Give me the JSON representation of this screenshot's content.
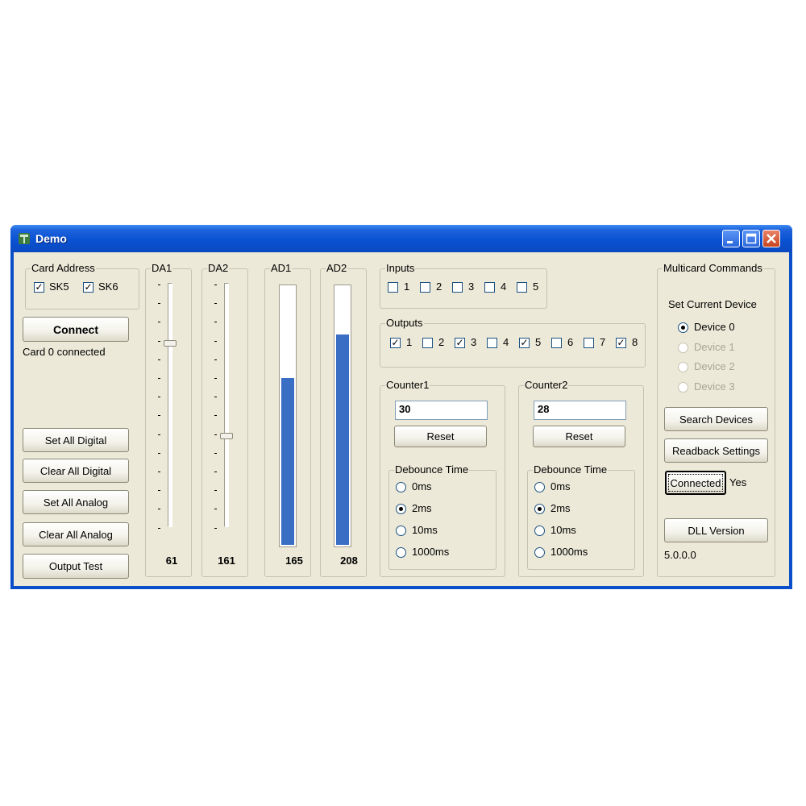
{
  "window": {
    "title": "Demo"
  },
  "card_address": {
    "group_label": "Card Address",
    "sk5": {
      "label": "SK5",
      "checked": true
    },
    "sk6": {
      "label": "SK6",
      "checked": true
    }
  },
  "connect": {
    "button_label": "Connect",
    "status": "Card 0 connected"
  },
  "left_buttons": {
    "set_all_digital": "Set All Digital",
    "clear_all_digital": "Clear All Digital",
    "set_all_analog": "Set All Analog",
    "clear_all_analog": "Clear All Analog",
    "output_test": "Output Test"
  },
  "sliders": {
    "da1": {
      "label": "DA1",
      "value": "61",
      "level": 61,
      "max": 255
    },
    "da2": {
      "label": "DA2",
      "value": "161",
      "level": 161,
      "max": 255
    }
  },
  "bars": {
    "ad1": {
      "label": "AD1",
      "value": "165",
      "level": 165,
      "max": 255
    },
    "ad2": {
      "label": "AD2",
      "value": "208",
      "level": 208,
      "max": 255
    }
  },
  "inputs": {
    "group_label": "Inputs",
    "items": [
      {
        "label": "1",
        "checked": false
      },
      {
        "label": "2",
        "checked": false
      },
      {
        "label": "3",
        "checked": false
      },
      {
        "label": "4",
        "checked": false
      },
      {
        "label": "5",
        "checked": false
      }
    ]
  },
  "outputs": {
    "group_label": "Outputs",
    "items": [
      {
        "label": "1",
        "checked": true
      },
      {
        "label": "2",
        "checked": false
      },
      {
        "label": "3",
        "checked": true
      },
      {
        "label": "4",
        "checked": false
      },
      {
        "label": "5",
        "checked": true
      },
      {
        "label": "6",
        "checked": false
      },
      {
        "label": "7",
        "checked": false
      },
      {
        "label": "8",
        "checked": true
      }
    ]
  },
  "counter1": {
    "group_label": "Counter1",
    "value": "30",
    "reset_label": "Reset",
    "debounce_label": "Debounce Time",
    "options": [
      "0ms",
      "2ms",
      "10ms",
      "1000ms"
    ],
    "selected": "2ms"
  },
  "counter2": {
    "group_label": "Counter2",
    "value": "28",
    "reset_label": "Reset",
    "debounce_label": "Debounce Time",
    "options": [
      "0ms",
      "2ms",
      "10ms",
      "1000ms"
    ],
    "selected": "2ms"
  },
  "multicard": {
    "group_label": "Multicard Commands",
    "set_device_label": "Set Current Device",
    "devices": [
      {
        "label": "Device 0",
        "selected": true,
        "enabled": true
      },
      {
        "label": "Device 1",
        "selected": false,
        "enabled": false
      },
      {
        "label": "Device 2",
        "selected": false,
        "enabled": false
      },
      {
        "label": "Device 3",
        "selected": false,
        "enabled": false
      }
    ],
    "search_label": "Search Devices",
    "readback_label": "Readback Settings",
    "connected_label": "Connected",
    "connected_value": "Yes",
    "dll_label": "DLL Version",
    "dll_value": "5.0.0.0"
  },
  "colors": {
    "title_blue": "#0a52d3",
    "face": "#ece9d8",
    "bar_fill": "#3a6ec5",
    "close_red": "#c8431c"
  }
}
